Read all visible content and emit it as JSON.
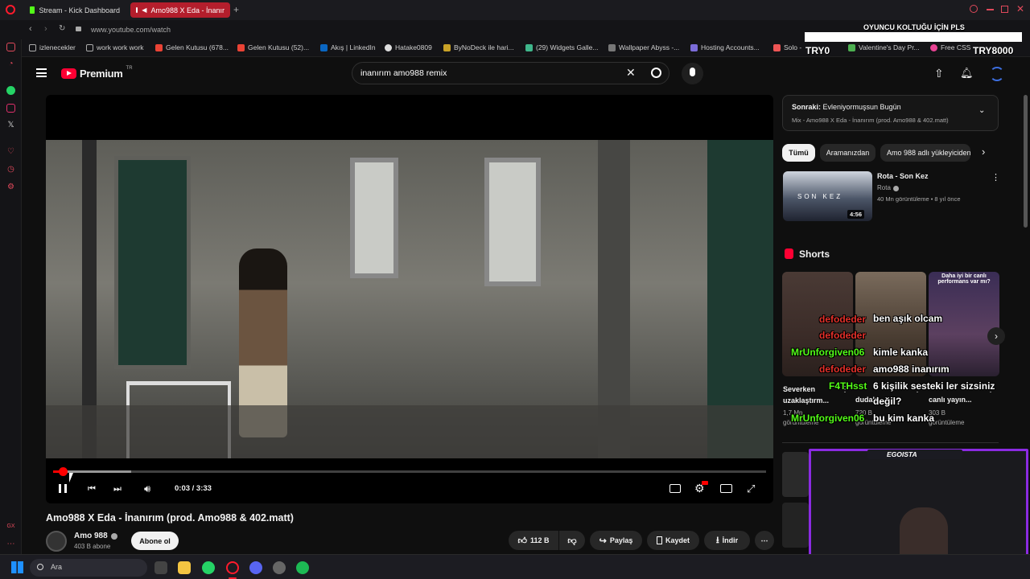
{
  "browser": {
    "tabs": [
      {
        "label": "Stream - Kick Dashboard",
        "active": false
      },
      {
        "label": "Amo988 X Eda - İnanır",
        "active": true
      }
    ],
    "url": "www.youtube.com/watch",
    "bookmarks": [
      "izlenecekler",
      "work work work",
      "Gelen Kutusu (678...",
      "Gelen Kutusu (52)...",
      "Akış | LinkedIn",
      "Hatake0809",
      "ByNoDeck ile hari...",
      "(29) Widgets Galle...",
      "Wallpaper Abyss -...",
      "Hosting Accounts...",
      "Solo -",
      "Valentine's Day Pr...",
      "Free CSS"
    ]
  },
  "youtube": {
    "logo": "Premium",
    "region": "TR",
    "search_query": "inanırım amo988 remix"
  },
  "video": {
    "title": "Amo988 X Eda - İnanırım (prod. Amo988 & 402.matt)",
    "time": "0:03 / 3:33",
    "progress": 0.014,
    "buffered": 0.11,
    "channel": "Amo 988",
    "subscribers": "403 B abone",
    "subscribe_label": "Abone ol",
    "likes": "112 B",
    "share_label": "Paylaş",
    "save_label": "Kaydet",
    "download_label": "İndir"
  },
  "sidebar_panel": {
    "next_label": "Sonraki:",
    "next_title": "Evleniyormuşsun Bugün",
    "mix_label": "Mix - Amo988 X Eda - İnanırım (prod. Amo988 & 402.matt)",
    "chips": [
      "Tümü",
      "Aramanızdan",
      "Amo 988 adlı yükleyiciden"
    ],
    "rec": {
      "title": "Rota - Son Kez",
      "channel": "Rota",
      "meta": "40 Mn görüntüleme • 8 yıl önce",
      "duration": "4:56",
      "thumb_text": "SON KEZ"
    },
    "shorts_label": "Shorts",
    "shorts": [
      {
        "title": "Severken uzaklaştırm...",
        "views": "1,7 Mn",
        "unit": "görüntüleme"
      },
      {
        "title": "dudakl...",
        "views": "720 B",
        "unit": "görüntüleme"
      },
      {
        "title": "canlı yayın...",
        "views": "303 B",
        "unit": "görüntüleme"
      }
    ],
    "short3_caption": "Daha iyi bir canlı performans var mı?"
  },
  "overlay": {
    "chat": [
      "defodeder",
      "ben aşık olcam",
      "defodeder",
      "MrUnforgiven06",
      "kimle kanka",
      "defodeder",
      "amo988 inanırım",
      "F4THsst",
      "6 kişilik sesteki ler sizsiniz",
      "değil?",
      "MrUnforgiven06",
      "bu kim kanka"
    ],
    "banner_text": "OYUNCU KOLTUĞU İÇİN PLS",
    "left_name": "TRY0",
    "right_name": "TRY8000",
    "cam_name": "EGOISTA"
  },
  "taskbar": {
    "search_placeholder": "Ara"
  },
  "colors": {
    "yt_red": "#ff0033",
    "accent_green": "#53fc18",
    "cam_border": "#8b2be2"
  }
}
